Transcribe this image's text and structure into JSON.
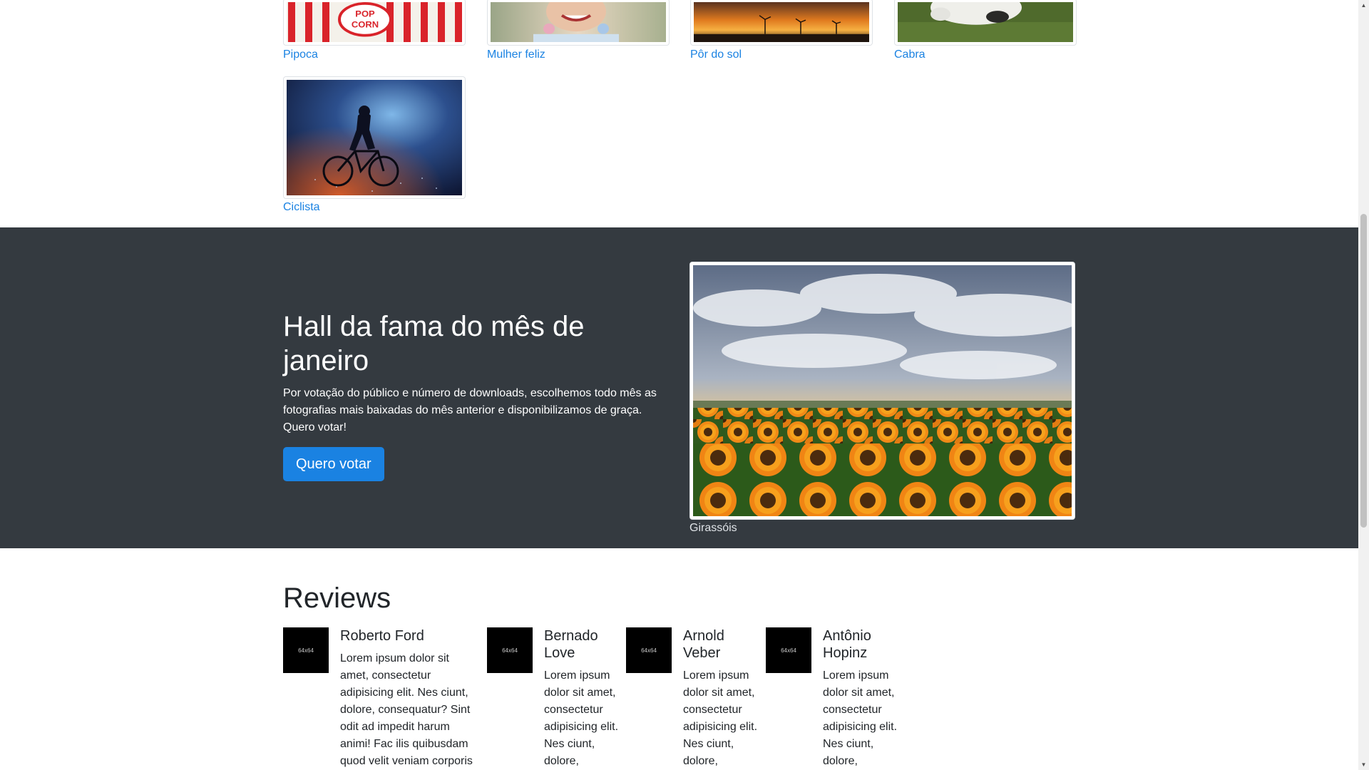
{
  "gallery": {
    "items": [
      {
        "caption": "Pipoca",
        "image": "popcorn-photo"
      },
      {
        "caption": "Mulher feliz",
        "image": "happy-woman-photo"
      },
      {
        "caption": "Pôr do sol",
        "image": "sunset-photo"
      },
      {
        "caption": "Cabra",
        "image": "goat-photo"
      },
      {
        "caption": "Ciclista",
        "image": "cyclist-photo"
      }
    ]
  },
  "hall": {
    "title": "Hall da fama do mês de janeiro",
    "text": "Por votação do público e número de downloads, escolhemos todo mês as fotografias mais baixadas do mês anterior e disponibilizamos de graça. Quero votar!",
    "button_label": "Quero votar",
    "image_caption": "Girassóis",
    "image": "sunflowers-photo"
  },
  "reviews": {
    "title": "Reviews",
    "items": [
      {
        "avatar_label": "64x64",
        "name": "Roberto Ford",
        "text": "Lorem ipsum dolor sit amet, consectetur adipisicing elit. Nes ciunt, dolore, consequatur? Sint odit ad impedit harum animi! Fac ilis quibusdam quod velit veniam corporis"
      },
      {
        "avatar_label": "64x64",
        "name": "Bernado Love",
        "text": "Lorem ipsum dolor sit amet, consectetur adipisicing elit. Nes ciunt, dolore,"
      },
      {
        "avatar_label": "64x64",
        "name": "Arnold Veber",
        "text": "Lorem ipsum dolor sit amet, consectetur adipisicing elit. Nes ciunt, dolore,"
      },
      {
        "avatar_label": "64x64",
        "name": "Antônio Hopinz",
        "text": "Lorem ipsum dolor sit amet, consectetur adipisicing elit. Nes ciunt, dolore,"
      }
    ]
  },
  "colors": {
    "accent": "#1a82e2",
    "dark_section": "#343a40"
  }
}
